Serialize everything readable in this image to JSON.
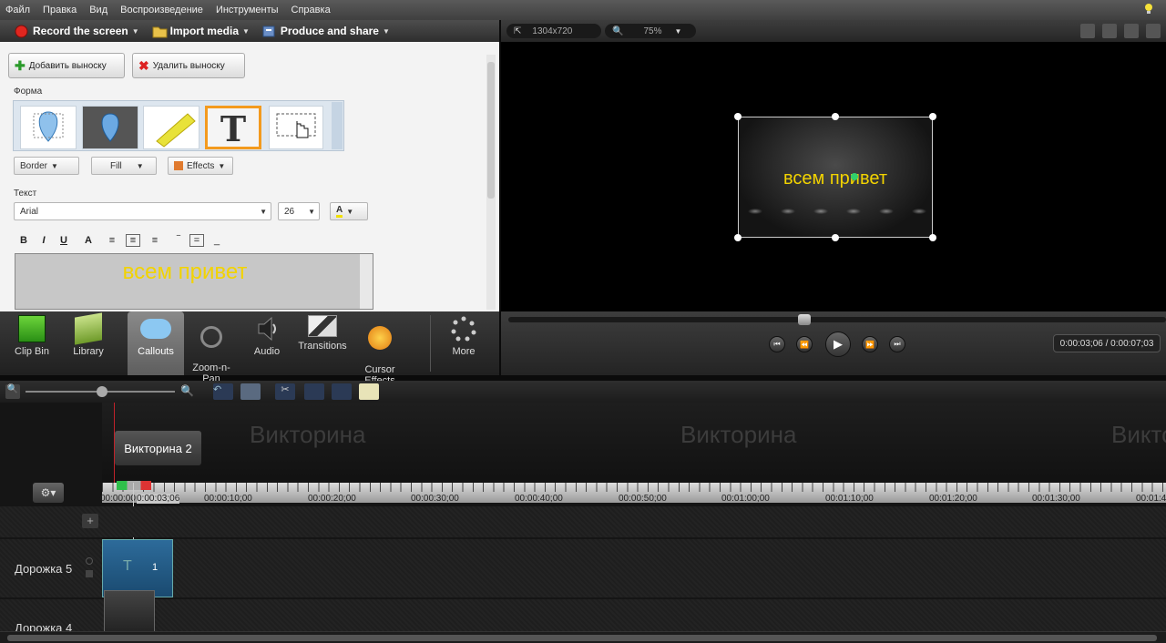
{
  "menu": [
    "Файл",
    "Правка",
    "Вид",
    "Воспроизведение",
    "Инструменты",
    "Справка"
  ],
  "toolbar": {
    "record": "Record the screen",
    "import": "Import media",
    "produce": "Produce and share"
  },
  "callouts": {
    "add_button": "Добавить выноску",
    "delete_button": "Удалить выноску",
    "shape_group": "Форма",
    "border": "Border",
    "fill": "Fill",
    "effects": "Effects",
    "text_group": "Текст",
    "font": "Arial",
    "size": "26",
    "format_bold": "B",
    "format_italic": "I",
    "format_underline": "U",
    "format_text": "A",
    "text_value": "всем привет"
  },
  "preview": {
    "dimensions": "1304x720",
    "zoom": "75%",
    "overlay_text": "всем привет",
    "time": "0:00:03;06 / 0:00:07;03"
  },
  "tasks": [
    {
      "label": "Clip Bin",
      "icon": "clip-bin-icon"
    },
    {
      "label": "Library",
      "icon": "library-icon"
    },
    {
      "label": "Callouts",
      "icon": "callouts-icon"
    },
    {
      "label": "Zoom-n-\nPan",
      "icon": "zoom-icon"
    },
    {
      "label": "Audio",
      "icon": "audio-icon"
    },
    {
      "label": "Transitions",
      "icon": "transitions-icon"
    },
    {
      "label": "Cursor\nEffects",
      "icon": "cursor-effects-icon"
    },
    {
      "label": "More",
      "icon": "more-icon"
    }
  ],
  "timeline": {
    "marker_label": "Викторина 2",
    "watermark": [
      "Викторина",
      "Викторина",
      "Викторин"
    ],
    "playhead_time": "0:00:03;06",
    "ticks": [
      "00:00:00;",
      "00:00:10;00",
      "00:00:20;00",
      "00:00:30;00",
      "00:00:40;00",
      "00:00:50;00",
      "00:01:00;00",
      "00:01:10;00",
      "00:01:20;00",
      "00:01:30;00",
      "00:01:4"
    ],
    "tracks": [
      "Дорожка 5",
      "Дорожка 4"
    ],
    "clip_number": "1"
  }
}
